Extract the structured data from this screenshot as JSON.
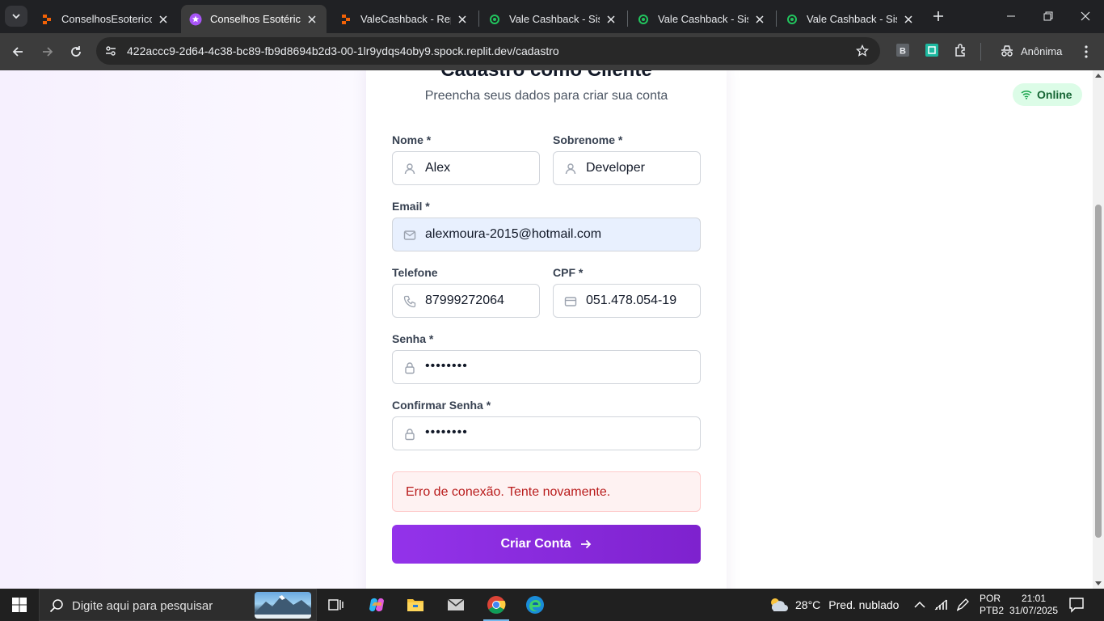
{
  "browser": {
    "tabs": [
      {
        "title": "ConselhosEsotericos - ",
        "active": false,
        "icon": "replit-icon"
      },
      {
        "title": "Conselhos Esotéricos",
        "active": true,
        "icon": "star-circle-icon"
      },
      {
        "title": "ValeCashback - Replit",
        "active": false,
        "icon": "replit-icon"
      },
      {
        "title": "Vale Cashback - Sistem",
        "active": false,
        "icon": "green-dot-icon"
      },
      {
        "title": "Vale Cashback - Sistem",
        "active": false,
        "icon": "green-dot-icon"
      },
      {
        "title": "Vale Cashback - Sistem",
        "active": false,
        "icon": "green-dot-icon"
      }
    ],
    "url": "422accc9-2d64-4c38-bc89-fb9d8694b2d3-00-1lr9ydqs4oby9.spock.replit.dev/cadastro",
    "profile_label": "Anônima",
    "colors": {
      "chrome_dark": "#202124",
      "toolbar": "#3c3c3c"
    }
  },
  "form": {
    "title": "Cadastro como Cliente",
    "subtitle": "Preencha seus dados para criar sua conta",
    "nome_label": "Nome *",
    "nome_value": "Alex",
    "sobrenome_label": "Sobrenome *",
    "sobrenome_value": "Developer",
    "email_label": "Email *",
    "email_value": "alexmoura-2015@hotmail.com",
    "telefone_label": "Telefone",
    "telefone_value": "87999272064",
    "cpf_label": "CPF *",
    "cpf_value": "051.478.054-19",
    "senha_label": "Senha *",
    "senha_value": "••••••••",
    "confirmar_label": "Confirmar Senha *",
    "confirmar_value": "••••••••",
    "error_message": "Erro de conexão. Tente novamente.",
    "submit_label": "Criar Conta",
    "colors": {
      "accent": "#9333ea",
      "error_bg": "#fef2f2",
      "error_text": "#b91c1c"
    }
  },
  "status": {
    "label": "Online",
    "color": "#166534"
  },
  "taskbar": {
    "search_placeholder": "Digite aqui para pesquisar",
    "weather_temp": "28°C",
    "weather_desc": "Pred. nublado",
    "lang_line1": "POR",
    "lang_line2": "PTB2",
    "time": "21:01",
    "date": "31/07/2025"
  }
}
